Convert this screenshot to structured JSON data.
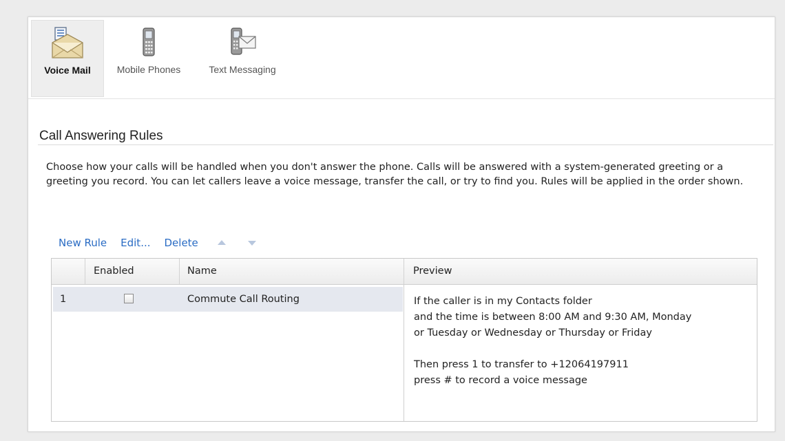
{
  "toolbar": {
    "items": [
      {
        "label": "Voice Mail",
        "icon": "voicemail-icon",
        "selected": true
      },
      {
        "label": "Mobile Phones",
        "icon": "mobile-phone-icon",
        "selected": false
      },
      {
        "label": "Text Messaging",
        "icon": "text-messaging-icon",
        "selected": false
      }
    ]
  },
  "section": {
    "title": "Call Answering Rules",
    "description": "Choose how your calls will be handled when you don't answer the phone. Calls will be answered with a system-generated greeting or a greeting you record. You can let callers leave a voice message, transfer the call, or try to find you. Rules will be applied in the order shown."
  },
  "actions": {
    "new_rule": "New Rule",
    "edit": "Edit...",
    "delete": "Delete",
    "move_up_icon": "arrow-up-icon",
    "move_down_icon": "arrow-down-icon"
  },
  "table": {
    "columns": [
      "",
      "Enabled",
      "Name",
      "Preview"
    ],
    "rows": [
      {
        "index": "1",
        "enabled": false,
        "name": "Commute Call Routing"
      }
    ],
    "preview_lines": [
      "If the caller is in my Contacts folder",
      "and the time is between 8:00 AM and 9:30 AM, Monday",
      "or Tuesday or Wednesday or Thursday or Friday",
      "",
      "Then press 1 to transfer to +12064197911",
      "press # to record a voice message"
    ]
  },
  "colors": {
    "link": "#2a6cc4",
    "selected_row": "#e5e8ef",
    "background": "#ececec"
  }
}
